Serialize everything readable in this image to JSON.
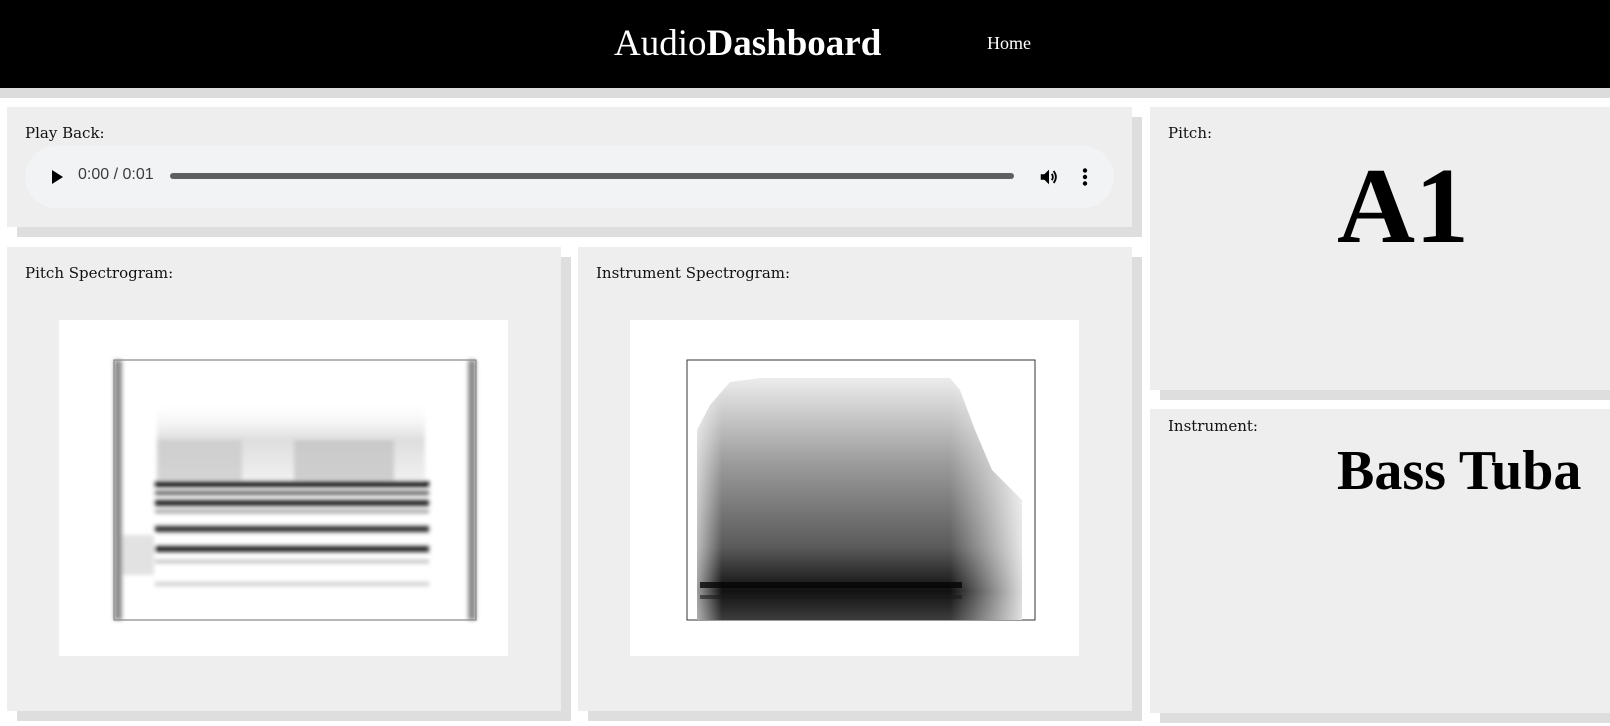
{
  "header": {
    "brand_light": "Audio",
    "brand_bold": "Dashboard",
    "nav_home": "Home"
  },
  "playback": {
    "label": "Play Back:",
    "time_display": "0:00 / 0:01",
    "progress": 0,
    "icons": [
      "play-icon",
      "volume-icon",
      "more-vert-icon"
    ]
  },
  "pitch_spectrogram": {
    "label": "Pitch Spectrogram:"
  },
  "instrument_spectrogram": {
    "label": "Instrument Spectrogram:"
  },
  "pitch": {
    "label": "Pitch:",
    "value": "A1"
  },
  "instrument": {
    "label": "Instrument:",
    "value": "Bass Tuba"
  },
  "colors": {
    "topbar": "#000000",
    "card_bg": "#eeeeee",
    "player_bg": "#f1f3f4"
  }
}
